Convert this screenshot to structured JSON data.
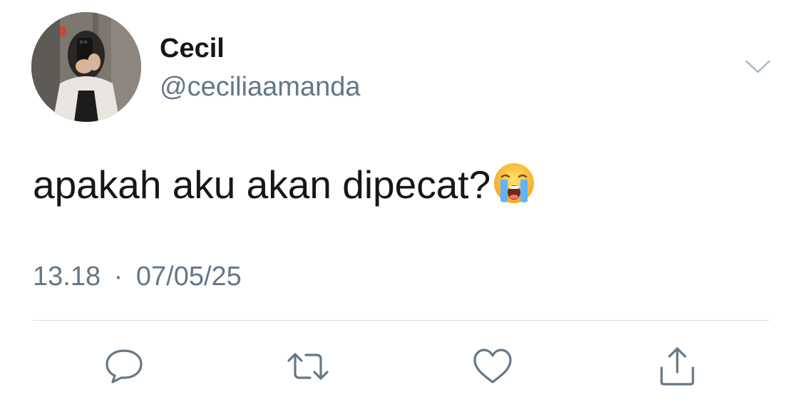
{
  "author": {
    "display_name": "Cecil",
    "handle": "@ceciliaamanda"
  },
  "tweet": {
    "text": "apakah aku akan dipecat?",
    "emoji": "loudly-crying-face",
    "time": "13.18",
    "separator": "·",
    "date": "07/05/25"
  },
  "icons": {
    "menu": "chevron-down-icon",
    "reply": "reply-icon",
    "retweet": "retweet-icon",
    "like": "heart-icon",
    "share": "share-icon"
  },
  "colors": {
    "text": "#14171a",
    "secondary": "#657786",
    "divider": "#d9dfe4",
    "icon": "#657786",
    "chevron": "#aab8c2"
  }
}
